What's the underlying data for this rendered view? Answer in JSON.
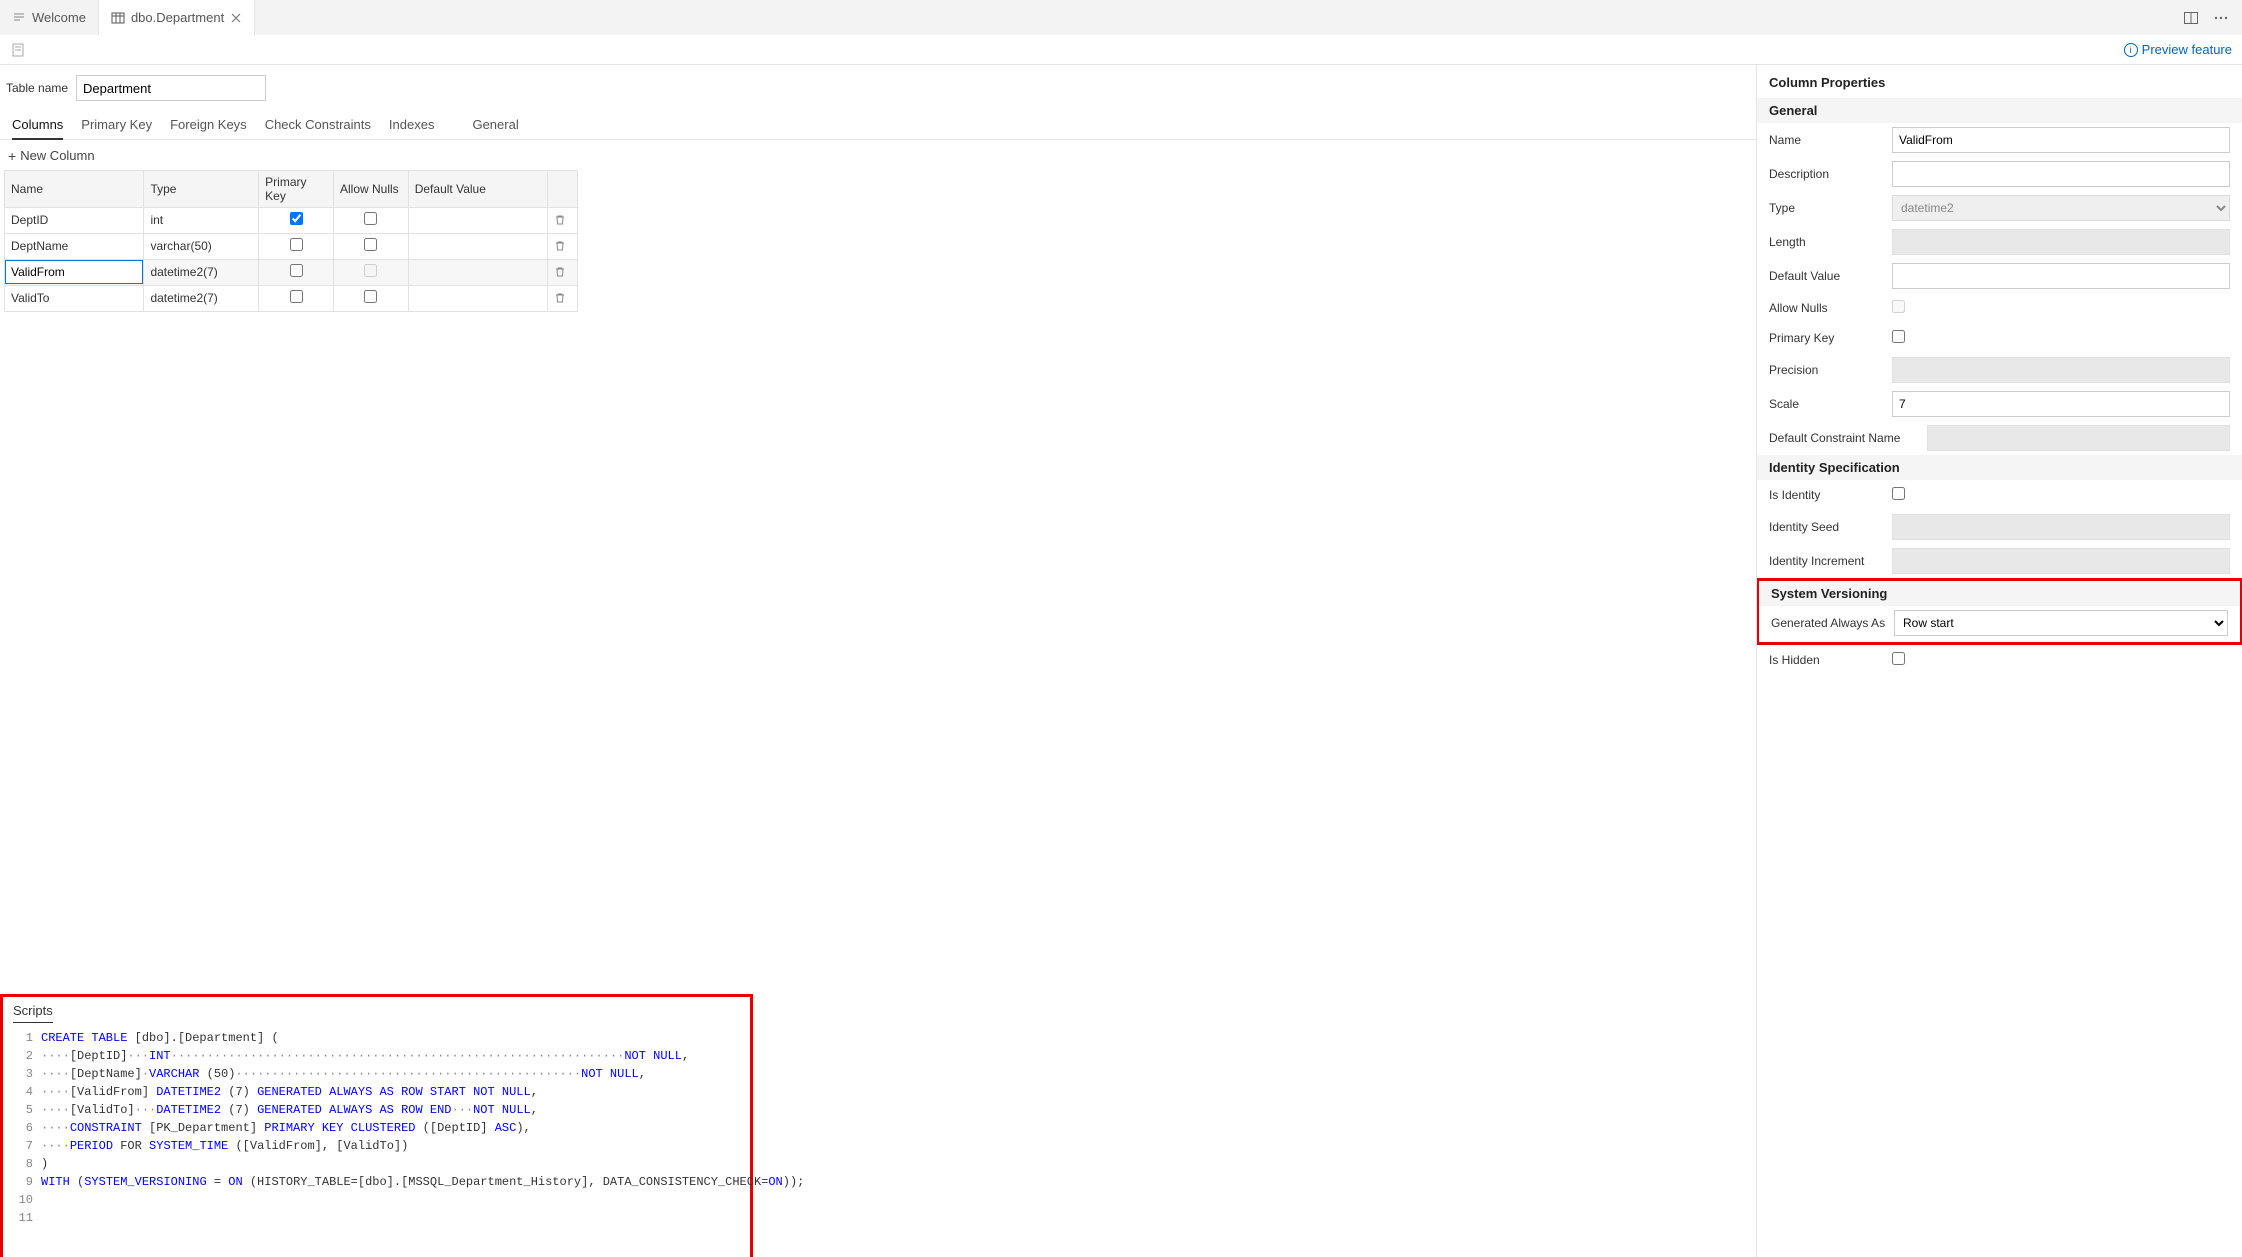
{
  "tabs": {
    "welcome": "Welcome",
    "current": "dbo.Department"
  },
  "toolbar": {
    "preview_feature": "Preview feature"
  },
  "table_name": {
    "label": "Table name",
    "value": "Department"
  },
  "sub_tabs": {
    "columns": "Columns",
    "primary_key": "Primary Key",
    "foreign_keys": "Foreign Keys",
    "check_constraints": "Check Constraints",
    "indexes": "Indexes",
    "general": "General"
  },
  "new_column_label": "New Column",
  "grid": {
    "headers": {
      "name": "Name",
      "type": "Type",
      "pk": "Primary Key",
      "nulls": "Allow Nulls",
      "default": "Default Value"
    },
    "rows": [
      {
        "name": "DeptID",
        "type": "int",
        "pk": true,
        "nulls": false
      },
      {
        "name": "DeptName",
        "type": "varchar(50)",
        "pk": false,
        "nulls": false
      },
      {
        "name": "ValidFrom",
        "type": "datetime2(7)",
        "pk": false,
        "nulls": false
      },
      {
        "name": "ValidTo",
        "type": "datetime2(7)",
        "pk": false,
        "nulls": false
      }
    ]
  },
  "scripts": {
    "label": "Scripts",
    "lines": [
      {
        "n": "1",
        "seg": [
          {
            "t": "CREATE TABLE",
            "c": "kw"
          },
          {
            "t": " [dbo].[Department] ("
          }
        ]
      },
      {
        "n": "2",
        "seg": [
          {
            "t": "····",
            "c": "gray"
          },
          {
            "t": "[DeptID]"
          },
          {
            "t": "···",
            "c": "gray"
          },
          {
            "t": "INT",
            "c": "kw"
          },
          {
            "t": "·······························································",
            "c": "gray"
          },
          {
            "t": "NOT NULL",
            "c": "kw"
          },
          {
            "t": ","
          }
        ]
      },
      {
        "n": "3",
        "seg": [
          {
            "t": "····",
            "c": "gray"
          },
          {
            "t": "[DeptName]"
          },
          {
            "t": "·",
            "c": "gray"
          },
          {
            "t": "VARCHAR",
            "c": "kw"
          },
          {
            "t": " (50)"
          },
          {
            "t": "················································",
            "c": "gray"
          },
          {
            "t": "NOT NULL",
            "c": "kw"
          },
          {
            "t": ","
          }
        ]
      },
      {
        "n": "4",
        "seg": [
          {
            "t": "····",
            "c": "gray"
          },
          {
            "t": "[ValidFrom] "
          },
          {
            "t": "DATETIME2",
            "c": "kw"
          },
          {
            "t": " (7) "
          },
          {
            "t": "GENERATED ALWAYS AS ROW START NOT NULL",
            "c": "kw"
          },
          {
            "t": ","
          }
        ]
      },
      {
        "n": "5",
        "seg": [
          {
            "t": "····",
            "c": "gray"
          },
          {
            "t": "[ValidTo]"
          },
          {
            "t": "···",
            "c": "gray"
          },
          {
            "t": "DATETIME2",
            "c": "kw"
          },
          {
            "t": " (7) "
          },
          {
            "t": "GENERATED ALWAYS AS ROW END",
            "c": "kw"
          },
          {
            "t": "···",
            "c": "gray"
          },
          {
            "t": "NOT NULL",
            "c": "kw"
          },
          {
            "t": ","
          }
        ]
      },
      {
        "n": "6",
        "seg": [
          {
            "t": "····",
            "c": "gray"
          },
          {
            "t": "CONSTRAINT",
            "c": "kw"
          },
          {
            "t": " [PK_Department] "
          },
          {
            "t": "PRIMARY KEY CLUSTERED",
            "c": "kw"
          },
          {
            "t": " ([DeptID] "
          },
          {
            "t": "ASC",
            "c": "kw"
          },
          {
            "t": "),"
          }
        ]
      },
      {
        "n": "7",
        "seg": [
          {
            "t": "····",
            "c": "gray"
          },
          {
            "t": "PERIOD",
            "c": "kw"
          },
          {
            "t": " FOR "
          },
          {
            "t": "SYSTEM_TIME",
            "c": "kw"
          },
          {
            "t": " ([ValidFrom], [ValidTo])"
          }
        ]
      },
      {
        "n": "8",
        "seg": [
          {
            "t": ")"
          }
        ]
      },
      {
        "n": "9",
        "seg": [
          {
            "t": "WITH",
            "c": "kw"
          },
          {
            "t": " ("
          },
          {
            "t": "SYSTEM_VERSIONING",
            "c": "kw"
          },
          {
            "t": " = "
          },
          {
            "t": "ON",
            "c": "kw"
          },
          {
            "t": " (HISTORY_TABLE=[dbo].[MSSQL_Department_History], DATA_CONSISTENCY_CHECK="
          },
          {
            "t": "ON",
            "c": "kw"
          },
          {
            "t": "));"
          }
        ]
      },
      {
        "n": "10",
        "seg": []
      },
      {
        "n": "11",
        "seg": []
      }
    ]
  },
  "props": {
    "title": "Column Properties",
    "general_section": "General",
    "identity_section": "Identity Specification",
    "versioning_section": "System Versioning",
    "labels": {
      "name": "Name",
      "description": "Description",
      "type": "Type",
      "length": "Length",
      "default_value": "Default Value",
      "allow_nulls": "Allow Nulls",
      "primary_key": "Primary Key",
      "precision": "Precision",
      "scale": "Scale",
      "default_constraint": "Default Constraint Name",
      "is_identity": "Is Identity",
      "identity_seed": "Identity Seed",
      "identity_increment": "Identity Increment",
      "generated_always": "Generated Always As",
      "is_hidden": "Is Hidden"
    },
    "values": {
      "name": "ValidFrom",
      "type": "datetime2",
      "scale": "7",
      "generated_always": "Row start"
    }
  }
}
